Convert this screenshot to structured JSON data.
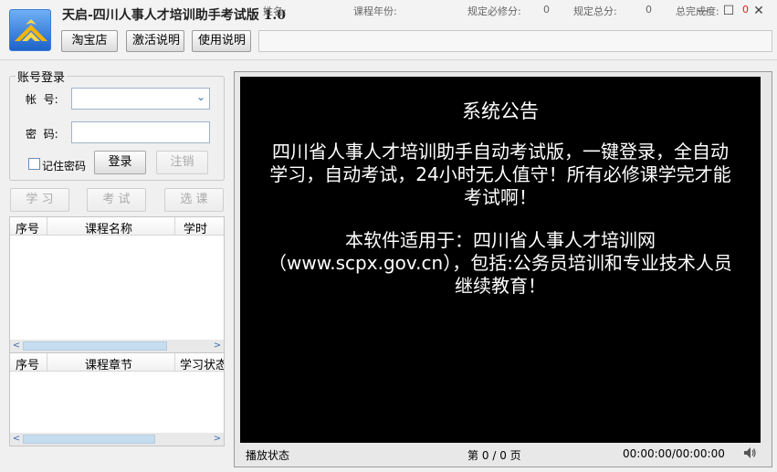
{
  "window": {
    "title": "天启-四川人事人才培训助手考试版 1.0",
    "minimize": "—",
    "maximize": "☐",
    "close": "✕"
  },
  "toolbar": {
    "taobao": "淘宝店",
    "activation": "激活说明",
    "usage": "使用说明"
  },
  "info": {
    "name_label": "姓名:",
    "name_value": "",
    "year_label": "课程年份:",
    "year_value": "",
    "required_credit_label": "规定必修分:",
    "required_credit_value": "0",
    "total_credit_label": "规定总分:",
    "total_credit_value": "0",
    "completion_label": "总完成度:",
    "completion_value": "0",
    "completion_color": "#e02020"
  },
  "login": {
    "group_title": "账号登录",
    "account_label": "帐  号:",
    "account_value": "",
    "password_label": "密  码:",
    "password_value": "",
    "remember_label": "记住密码",
    "login_button": "登录",
    "logout_button": "注销"
  },
  "actions": {
    "study": "学 习",
    "exam": "考 试",
    "select_course": "选 课"
  },
  "course_list": {
    "columns": [
      "序号",
      "课程名称",
      "学时"
    ]
  },
  "chapter_list": {
    "columns": [
      "序号",
      "课程章节",
      "学习状态"
    ]
  },
  "notice": {
    "title": "系统公告",
    "body_1": "四川省人事人才培训助手自动考试版，一键登录，全自动学习，自动考试，24小时无人值守！所有必修课学完才能考试啊！",
    "body_2": "本软件适用于：四川省人事人才培训网（www.scpx.gov.cn），包括:公务员培训和专业技术人员继续教育！"
  },
  "player": {
    "status_label": "播放状态",
    "page_prefix": "第",
    "page_current": "0",
    "page_sep": "/",
    "page_total": "0",
    "page_suffix": "页",
    "time": "00:00:00/00:00:00",
    "volume_icon": "speaker-icon"
  }
}
